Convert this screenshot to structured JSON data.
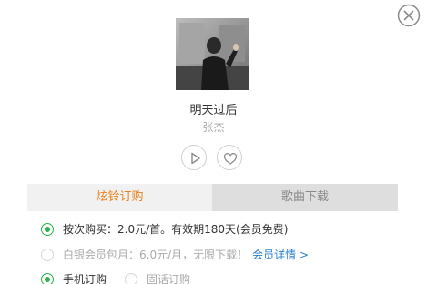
{
  "song": {
    "title": "明天过后",
    "singer": "张杰"
  },
  "tabs": [
    {
      "label": "炫铃订购",
      "active": true
    },
    {
      "label": "歌曲下载",
      "active": false
    }
  ],
  "options": {
    "per_song": {
      "text": "按次购买：2.0元/首。有效期180天(会员免费)",
      "selected": true
    },
    "monthly": {
      "text": "白银会员包月：6.0元/月，无限下载！",
      "link": "会员详情 >",
      "selected": false
    }
  },
  "order_type": {
    "mobile": {
      "label": "手机订购",
      "selected": true
    },
    "landline": {
      "label": "固话订购",
      "selected": false
    }
  },
  "colors": {
    "accent": "#e8821e",
    "radio_selected": "#2bb24c",
    "link": "#2b7fd0"
  },
  "icons": {
    "close": "close-icon",
    "play": "play-icon",
    "favorite": "heart-icon"
  }
}
